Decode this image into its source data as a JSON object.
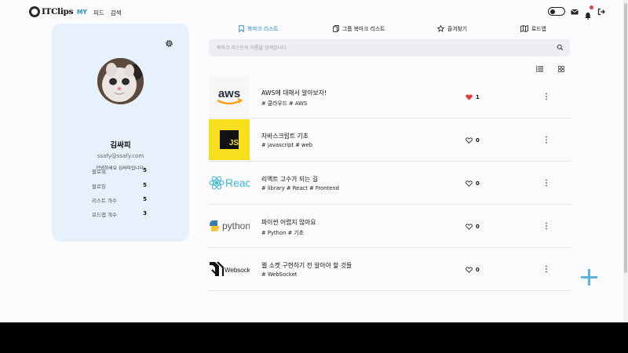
{
  "header": {
    "logo_text": "ITClips",
    "nav": [
      "MY",
      "피드",
      "검색"
    ]
  },
  "profile": {
    "name": "김싸피",
    "email": "ssafy@ssafy.com",
    "intro": "안녕하세요 김싸피입니다.",
    "stats": [
      {
        "label": "팔로워",
        "value": "5"
      },
      {
        "label": "팔로잉",
        "value": "5"
      },
      {
        "label": "리스트 개수",
        "value": "5"
      },
      {
        "label": "로드맵 개수",
        "value": "3"
      }
    ]
  },
  "tabs": [
    "북마크 리스트",
    "그룹 북마크 리스트",
    "즐겨찾기",
    "로드맵"
  ],
  "search": {
    "placeholder": "북마크 리스트의 이름을 검색합니다",
    "value": ""
  },
  "items": [
    {
      "title": "AWS에 대해서 알아보자!",
      "tags": "# 클라우드 # AWS",
      "likes": "1",
      "liked": true,
      "thumb_text": "aws"
    },
    {
      "title": "자바스크립트 기초",
      "tags": "# javascript # web",
      "likes": "0",
      "liked": false,
      "thumb_text": "JS"
    },
    {
      "title": "리액트 고수가 되는 길",
      "tags": "# library # React # Frontend",
      "likes": "0",
      "liked": false,
      "thumb_text": "React"
    },
    {
      "title": "파이썬 어렵지 않아요",
      "tags": "# Python # 기초",
      "likes": "0",
      "liked": false,
      "thumb_text": "python"
    },
    {
      "title": "웹 소켓 구현하기 전 알아야 할 것들",
      "tags": "# WebSocket",
      "likes": "0",
      "liked": false,
      "thumb_text": "Websocket"
    }
  ],
  "colors": {
    "accent": "#2a90d4",
    "like": "#e53935",
    "card": "#e6f1fb"
  }
}
